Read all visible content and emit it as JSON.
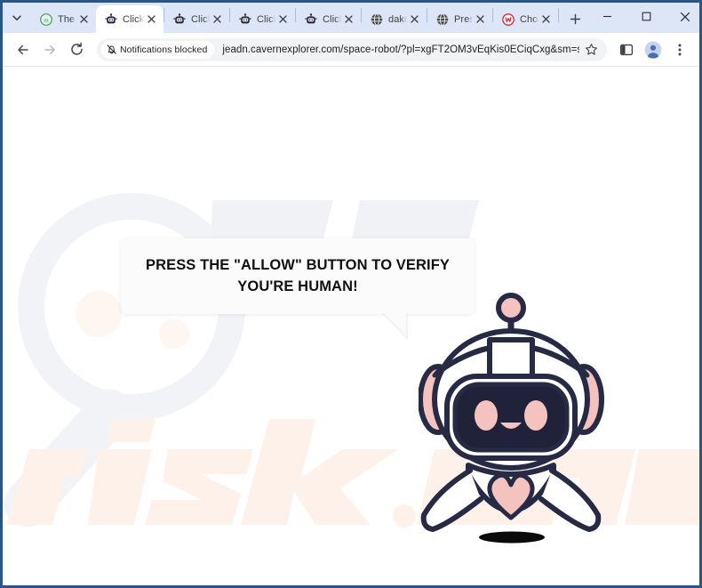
{
  "browser": {
    "tab_search_tooltip": "Search tabs",
    "tabs": [
      {
        "title": "The",
        "favicon": "green-m-icon",
        "active": false
      },
      {
        "title": "Click",
        "favicon": "robot-icon",
        "active": true
      },
      {
        "title": "Click",
        "favicon": "robot-icon",
        "active": false
      },
      {
        "title": "Click",
        "favicon": "robot-icon",
        "active": false
      },
      {
        "title": "Click",
        "favicon": "robot-icon",
        "active": false
      },
      {
        "title": "dako",
        "favicon": "globe-icon",
        "active": false
      },
      {
        "title": "Pres",
        "favicon": "globe-icon",
        "active": false
      },
      {
        "title": "Cho",
        "favicon": "red-w-icon",
        "active": false
      }
    ],
    "new_tab_label": "+",
    "window_controls": {
      "minimize": "minimize-icon",
      "maximize": "maximize-icon",
      "close": "close-icon"
    },
    "toolbar": {
      "back": "back-arrow-icon",
      "forward": "forward-arrow-icon",
      "reload": "reload-icon",
      "notifications_chip": "Notifications blocked",
      "notifications_chip_icon": "bell-slash-icon",
      "url": "jeadn.cavernexplorer.com/space-robot/?pl=xgFT2OM3vEqKis0ECiqCxg&sm=space-robot...",
      "bookmark": "star-icon",
      "side_panel": "side-panel-icon",
      "profile": "profile-avatar-icon",
      "menu": "three-dot-menu-icon"
    }
  },
  "page": {
    "message_line1": "PRESS THE \"ALLOW\" BUTTON TO VERIFY",
    "message_line2": "YOU'RE HUMAN!",
    "illustration": "space-robot-mascot",
    "watermark": "pcrisk.com"
  },
  "colors": {
    "tabstrip_bg": "#dce6f7",
    "window_border": "#2d5486",
    "robot_outline": "#272a45",
    "robot_pink": "#f4c3c0",
    "robot_face": "#1f2238",
    "bubble_bg": "#fbfbfb",
    "omnibox_bg": "#f1f3f4",
    "profile_blue": "#5b7fc4"
  }
}
